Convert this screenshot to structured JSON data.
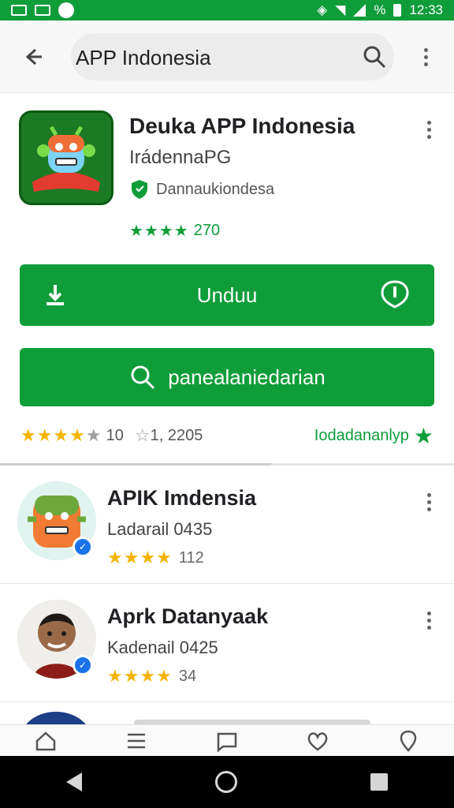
{
  "status_bar": {
    "time": "12:33",
    "battery_text": "%",
    "icons": [
      "notification-box-icon",
      "image-icon",
      "clock-icon",
      "vibrate-icon",
      "wifi-icon",
      "signal-icon",
      "battery-icon"
    ]
  },
  "search": {
    "query": "APP Indonesia",
    "icons": [
      "back-arrow-icon",
      "search-icon",
      "more-vert-icon"
    ]
  },
  "app": {
    "title": "Deuka APP Indonesia",
    "developer": "IrádennaPG",
    "verified_text": "Dannaukiondesa",
    "rating_stars": "★★★★",
    "rating_count": "270",
    "accent_color": "#0f9d3a"
  },
  "actions": {
    "primary_label": "Unduu",
    "secondary_label": "panealaniedarian"
  },
  "summary": {
    "rating_text": "10",
    "reviews_text": "1, 2205",
    "link_text": "Iodadananlyp"
  },
  "results": [
    {
      "title": "APIK Imdensia",
      "subtitle": "Ladarail 0435",
      "stars": "★★★★",
      "count": "112"
    },
    {
      "title": "Aprk Datanyaak",
      "subtitle": "Kadenail 0425",
      "stars": "★★★★",
      "count": "34"
    }
  ],
  "bottom_nav": {
    "icons": [
      "home-icon",
      "list-icon",
      "chat-icon",
      "heart-icon",
      "location-icon"
    ]
  },
  "system_nav": {
    "icons": [
      "triangle-back-icon",
      "circle-home-icon",
      "square-recents-icon"
    ]
  }
}
